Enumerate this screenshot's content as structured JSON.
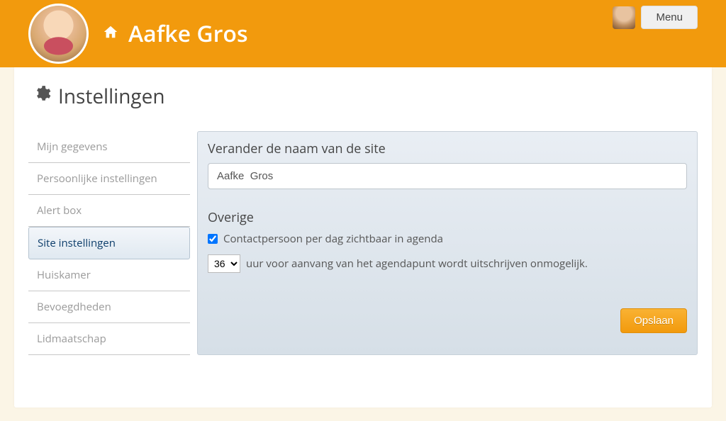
{
  "header": {
    "title": "Aafke Gros",
    "menu_label": "Menu"
  },
  "page": {
    "title": "Instellingen"
  },
  "sidebar": {
    "items": [
      {
        "label": "Mijn gegevens",
        "active": false
      },
      {
        "label": "Persoonlijke instellingen",
        "active": false
      },
      {
        "label": "Alert box",
        "active": false
      },
      {
        "label": "Site instellingen",
        "active": true
      },
      {
        "label": "Huiskamer",
        "active": false
      },
      {
        "label": "Bevoegdheden",
        "active": false
      },
      {
        "label": "Lidmaatschap",
        "active": false
      }
    ]
  },
  "panel": {
    "rename_label": "Verander de naam van de site",
    "site_name_value": "Aafke  Gros",
    "other_label": "Overige",
    "contact_checkbox_label": "Contactpersoon per dag zichtbaar in agenda",
    "contact_checked": true,
    "hours_value": "36",
    "hours_suffix": "uur voor aanvang van het agendapunt wordt uitschrijven onmogelijk.",
    "save_label": "Opslaan"
  }
}
